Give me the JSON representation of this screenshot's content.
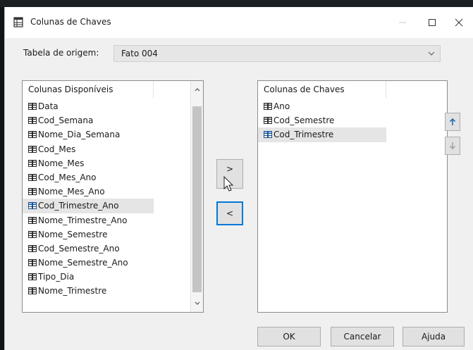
{
  "window": {
    "title": "Colunas de Chaves",
    "icon": "table-keys-icon",
    "controls": {
      "minimize": "minimize-icon",
      "maximize": "maximize-icon",
      "close": "close-icon"
    }
  },
  "origin": {
    "label": "Tabela de origem:",
    "selected": "Fato 004"
  },
  "available": {
    "header": "Colunas Disponíveis",
    "items": [
      "Data",
      "Cod_Semana",
      "Nome_Dia_Semana",
      "Cod_Mes",
      "Nome_Mes",
      "Cod_Mes_Ano",
      "Nome_Mes_Ano",
      "Cod_Trimestre_Ano",
      "Nome_Trimestre_Ano",
      "Nome_Semestre",
      "Cod_Semestre_Ano",
      "Nome_Semestre_Ano",
      "Tipo_Dia",
      "Nome_Trimestre"
    ],
    "selected": "Cod_Trimestre_Ano"
  },
  "keys": {
    "header": "Colunas de Chaves",
    "items": [
      "Ano",
      "Cod_Semestre",
      "Cod_Trimestre"
    ],
    "selected": "Cod_Trimestre"
  },
  "move_buttons": {
    "add": ">",
    "remove": "<"
  },
  "footer": {
    "ok": "OK",
    "cancel": "Cancelar",
    "help": "Ajuda"
  },
  "colors": {
    "accent": "#0078d7",
    "arrow_up": "#1f6fb2",
    "dialog_bg": "#f0f0f0",
    "selection": "#e5e5e5"
  }
}
